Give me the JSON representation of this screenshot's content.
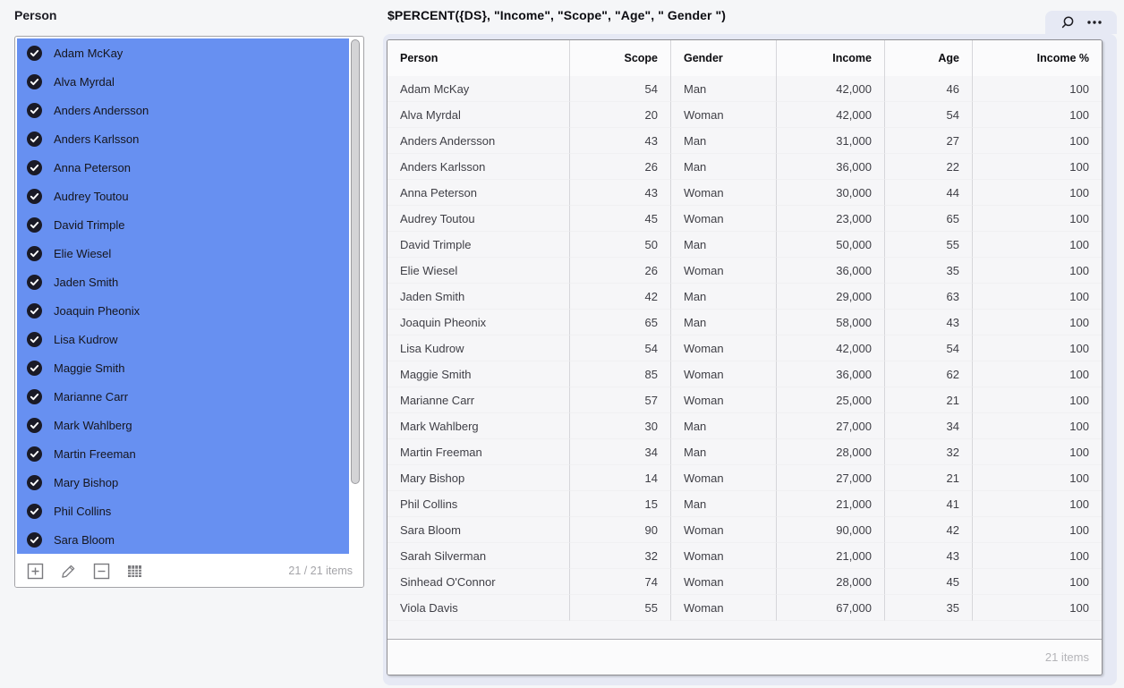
{
  "colors": {
    "page_bg": "#f5f6f8",
    "selection_blue": "#6790f1",
    "check_circle": "#1a1a26",
    "panel_lavender": "#e6e9f4",
    "table_border": "#8e8e92",
    "divider": "#d6d6da"
  },
  "filter_panel": {
    "title": "Person",
    "count_label": "21 / 21 items",
    "selected_visible_items": [
      "Adam McKay",
      "Alva Myrdal",
      "Anders Andersson",
      "Anders Karlsson",
      "Anna Peterson",
      "Audrey Toutou",
      "David Trimple",
      "Elie Wiesel",
      "Jaden Smith",
      "Joaquin Pheonix",
      "Lisa Kudrow",
      "Maggie Smith",
      "Marianne Carr",
      "Mark Wahlberg",
      "Martin Freeman",
      "Mary Bishop",
      "Phil Collins",
      "Sara Bloom"
    ],
    "toolbar_icons": [
      "plus-square",
      "pencil",
      "minus-square",
      "grid"
    ]
  },
  "table_panel": {
    "title": "$PERCENT({DS}, \"Income\", \"Scope\", \"Age\", \" Gender \")",
    "toolbar_icons": [
      "search",
      "more-menu"
    ],
    "columns": [
      {
        "label": "Person",
        "align": "left"
      },
      {
        "label": "Scope",
        "align": "right"
      },
      {
        "label": "Gender",
        "align": "left"
      },
      {
        "label": "Income",
        "align": "right"
      },
      {
        "label": "Age",
        "align": "right"
      },
      {
        "label": "Income %",
        "align": "right"
      }
    ],
    "rows": [
      [
        "Adam McKay",
        "54",
        "Man",
        "42,000",
        "46",
        "100"
      ],
      [
        "Alva Myrdal",
        "20",
        "Woman",
        "42,000",
        "54",
        "100"
      ],
      [
        "Anders Andersson",
        "43",
        "Man",
        "31,000",
        "27",
        "100"
      ],
      [
        "Anders Karlsson",
        "26",
        "Man",
        "36,000",
        "22",
        "100"
      ],
      [
        "Anna Peterson",
        "43",
        "Woman",
        "30,000",
        "44",
        "100"
      ],
      [
        "Audrey Toutou",
        "45",
        "Woman",
        "23,000",
        "65",
        "100"
      ],
      [
        "David Trimple",
        "50",
        "Man",
        "50,000",
        "55",
        "100"
      ],
      [
        "Elie Wiesel",
        "26",
        "Woman",
        "36,000",
        "35",
        "100"
      ],
      [
        "Jaden Smith",
        "42",
        "Man",
        "29,000",
        "63",
        "100"
      ],
      [
        "Joaquin Pheonix",
        "65",
        "Man",
        "58,000",
        "43",
        "100"
      ],
      [
        "Lisa Kudrow",
        "54",
        "Woman",
        "42,000",
        "54",
        "100"
      ],
      [
        "Maggie Smith",
        "85",
        "Woman",
        "36,000",
        "62",
        "100"
      ],
      [
        "Marianne Carr",
        "57",
        "Woman",
        "25,000",
        "21",
        "100"
      ],
      [
        "Mark Wahlberg",
        "30",
        "Man",
        "27,000",
        "34",
        "100"
      ],
      [
        "Martin Freeman",
        "34",
        "Man",
        "28,000",
        "32",
        "100"
      ],
      [
        "Mary Bishop",
        "14",
        "Woman",
        "27,000",
        "21",
        "100"
      ],
      [
        "Phil Collins",
        "15",
        "Man",
        "21,000",
        "41",
        "100"
      ],
      [
        "Sara Bloom",
        "90",
        "Woman",
        "90,000",
        "42",
        "100"
      ],
      [
        "Sarah Silverman",
        "32",
        "Woman",
        "21,000",
        "43",
        "100"
      ],
      [
        "Sinhead O'Connor",
        "74",
        "Woman",
        "28,000",
        "45",
        "100"
      ],
      [
        "Viola Davis",
        "55",
        "Woman",
        "67,000",
        "35",
        "100"
      ]
    ],
    "footer_count": "21 items"
  }
}
